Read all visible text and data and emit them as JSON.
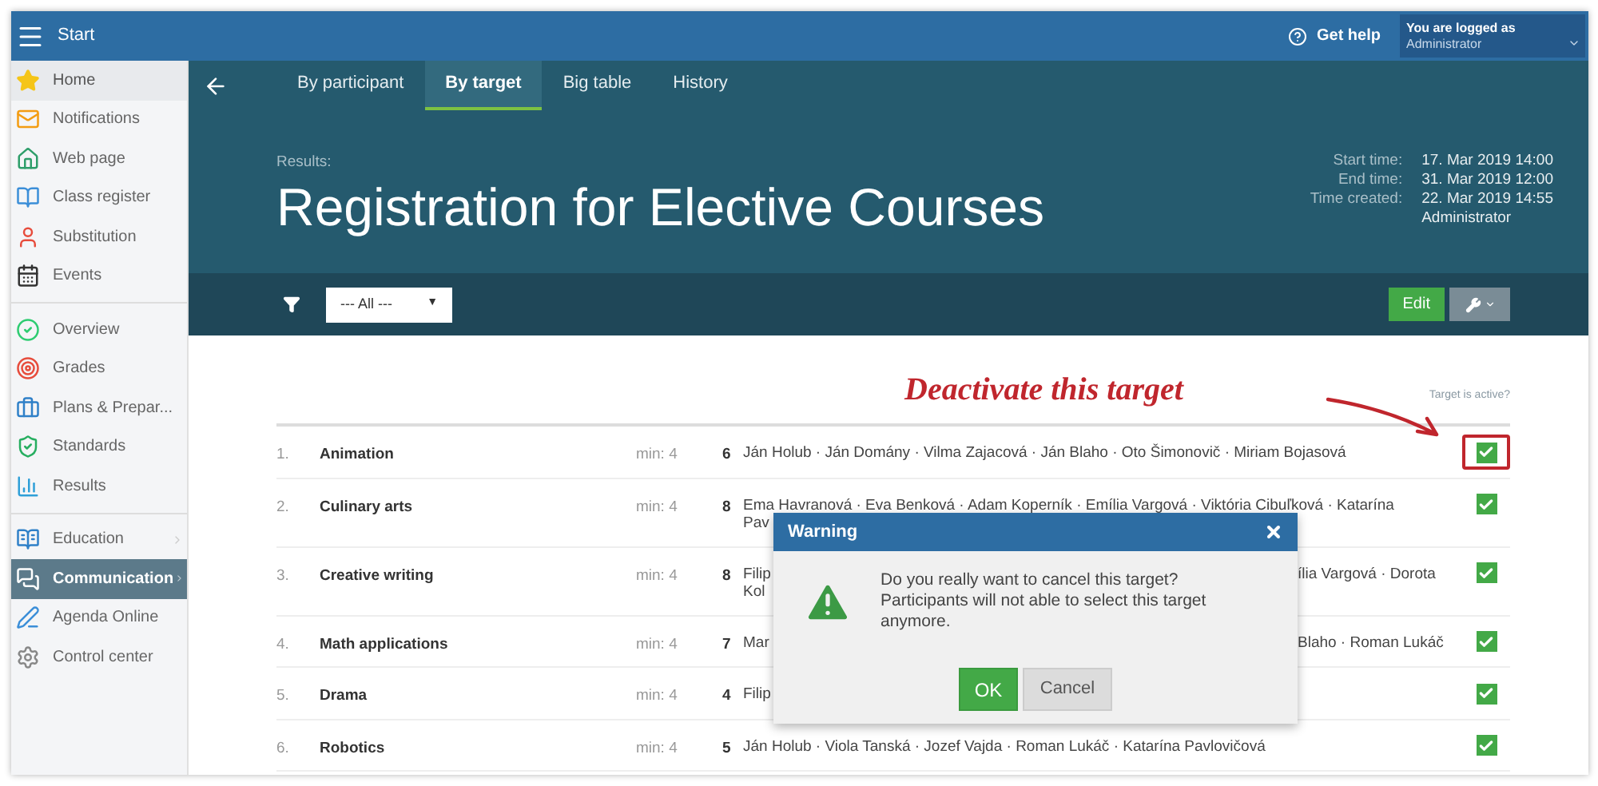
{
  "topbar": {
    "title": "Start",
    "help": "Get help",
    "user_label": "You are logged as",
    "user_name": "Administrator"
  },
  "sidebar": {
    "groups": [
      [
        {
          "label": "Home",
          "selected": false,
          "hover": true,
          "submenu": false
        },
        {
          "label": "Notifications",
          "selected": false,
          "hover": false,
          "submenu": false
        },
        {
          "label": "Web page",
          "selected": false,
          "hover": false,
          "submenu": false
        },
        {
          "label": "Class register",
          "selected": false,
          "hover": false,
          "submenu": false
        },
        {
          "label": "Substitution",
          "selected": false,
          "hover": false,
          "submenu": false
        },
        {
          "label": "Events",
          "selected": false,
          "hover": false,
          "submenu": false
        }
      ],
      [
        {
          "label": "Overview",
          "selected": false,
          "hover": false,
          "submenu": false
        },
        {
          "label": "Grades",
          "selected": false,
          "hover": false,
          "submenu": false
        },
        {
          "label": "Plans & Prepar...",
          "selected": false,
          "hover": false,
          "submenu": false
        },
        {
          "label": "Standards",
          "selected": false,
          "hover": false,
          "submenu": false
        },
        {
          "label": "Results",
          "selected": false,
          "hover": false,
          "submenu": false
        }
      ],
      [
        {
          "label": "Education",
          "selected": false,
          "hover": false,
          "submenu": true
        },
        {
          "label": "Communication",
          "selected": true,
          "hover": false,
          "submenu": true
        },
        {
          "label": "Agenda Online",
          "selected": false,
          "hover": false,
          "submenu": false
        },
        {
          "label": "Control center",
          "selected": false,
          "hover": false,
          "submenu": false
        }
      ]
    ]
  },
  "tabs": [
    {
      "label": "By participant",
      "selected": false
    },
    {
      "label": "By target",
      "selected": true
    },
    {
      "label": "Big table",
      "selected": false
    },
    {
      "label": "History",
      "selected": false
    }
  ],
  "header": {
    "subtitle": "Results:",
    "title": "Registration for Elective Courses",
    "meta": [
      {
        "label": "Start time:",
        "value": "17. Mar 2019 14:00"
      },
      {
        "label": "End time:",
        "value": "31. Mar 2019 12:00"
      },
      {
        "label": "Time created:",
        "value": "22. Mar 2019 14:55",
        "extra": "Administrator"
      }
    ]
  },
  "toolbar": {
    "filter_value": "--- All ---",
    "filter_caret": "▼",
    "edit": "Edit"
  },
  "annotation": "Deactivate this target",
  "table": {
    "active_header": "Target is active?",
    "rows": [
      {
        "number": "1.",
        "name": "Animation",
        "min": "min: 4",
        "count": "6",
        "active": true,
        "highlighted": true,
        "lines": [
          [
            "Ján Holub · Ján Domány · Vilma Zajacová · Ján Blaho · Oto Šimonovič · Miriam Bojasová"
          ]
        ]
      },
      {
        "number": "2.",
        "name": "Culinary arts",
        "min": "min: 4",
        "count": "8",
        "active": true,
        "highlighted": false,
        "lines": [
          [
            "Ema Havranová · Eva Benková · Adam Koperník · Emília Vargová · Viktória Cibuľková · Katarína"
          ],
          [
            "Pav"
          ]
        ]
      },
      {
        "number": "3.",
        "name": "Creative writing",
        "min": "min: 4",
        "count": "8",
        "active": true,
        "highlighted": false,
        "lines": [
          [
            "Filip",
            "ília Vargová · Dorota"
          ],
          [
            "Kol"
          ]
        ]
      },
      {
        "number": "4.",
        "name": "Math applications",
        "min": "min: 4",
        "count": "7",
        "active": true,
        "highlighted": false,
        "lines": [
          [
            "Mar",
            "Blaho · Roman Lukáč"
          ]
        ]
      },
      {
        "number": "5.",
        "name": "Drama",
        "min": "min: 4",
        "count": "4",
        "active": true,
        "highlighted": false,
        "lines": [
          [
            "Filip"
          ]
        ]
      },
      {
        "number": "6.",
        "name": "Robotics",
        "min": "min: 4",
        "count": "5",
        "active": true,
        "highlighted": false,
        "lines": [
          [
            "Ján Holub · Viola Tanská · Jozef Vajda · Roman Lukáč · Katarína Pavlovičová"
          ]
        ]
      }
    ]
  },
  "dialog": {
    "title": "Warning",
    "message": "Do you really want to cancel this target? Participants will not able to select this target anymore.",
    "ok": "OK",
    "cancel": "Cancel"
  }
}
